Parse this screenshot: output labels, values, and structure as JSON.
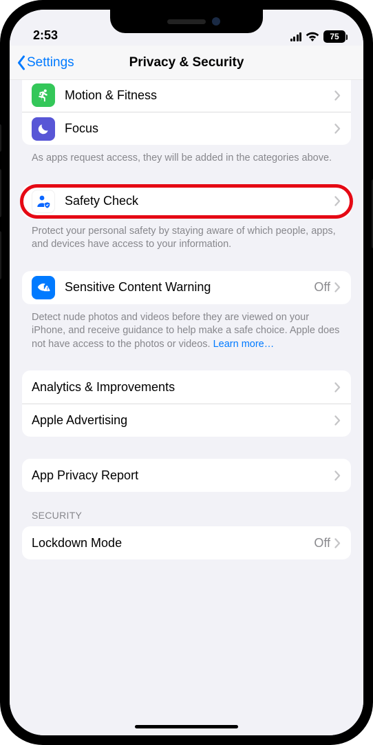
{
  "status": {
    "time": "2:53",
    "battery": "75"
  },
  "nav": {
    "back": "Settings",
    "title": "Privacy & Security"
  },
  "group1": {
    "motion": "Motion & Fitness",
    "focus": "Focus",
    "footer": "As apps request access, they will be added in the categories above."
  },
  "safety": {
    "label": "Safety Check",
    "footer": "Protect your personal safety by staying aware of which people, apps, and devices have access to your information."
  },
  "sensitive": {
    "label": "Sensitive Content Warning",
    "value": "Off",
    "footer": "Detect nude photos and videos before they are viewed on your iPhone, and receive guidance to help make a safe choice. Apple does not have access to the photos or videos. ",
    "learn_more": "Learn more…"
  },
  "analytics": {
    "analytics": "Analytics & Improvements",
    "advertising": "Apple Advertising"
  },
  "privacy_report": {
    "label": "App Privacy Report"
  },
  "security": {
    "header": "SECURITY",
    "lockdown": "Lockdown Mode",
    "lockdown_value": "Off"
  },
  "icons": {
    "motion": "runner-icon",
    "focus": "moon-icon",
    "safety": "person-shield-icon",
    "sensitive": "eye-warning-icon"
  }
}
